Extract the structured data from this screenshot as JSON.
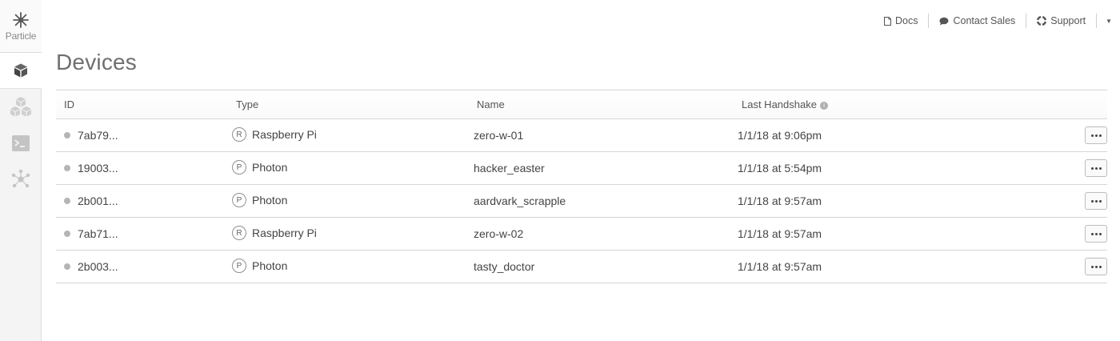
{
  "sidebar": {
    "logo_text": "Particle",
    "items": [
      {
        "name": "devices",
        "icon": "cube-icon",
        "active": true
      },
      {
        "name": "products",
        "icon": "cubes-icon",
        "active": false
      },
      {
        "name": "console",
        "icon": "terminal-icon",
        "active": false
      },
      {
        "name": "integrations",
        "icon": "network-icon",
        "active": false
      }
    ]
  },
  "toplinks": {
    "docs": "Docs",
    "contact_sales": "Contact Sales",
    "support": "Support"
  },
  "page_title": "Devices",
  "table": {
    "columns": {
      "id": "ID",
      "type": "Type",
      "name": "Name",
      "last_handshake": "Last Handshake"
    },
    "rows": [
      {
        "id": "7ab79...",
        "type_badge": "R",
        "type": "Raspberry Pi",
        "name": "zero-w-01",
        "last_handshake": "1/1/18 at 9:06pm"
      },
      {
        "id": "19003...",
        "type_badge": "P",
        "type": "Photon",
        "name": "hacker_easter",
        "last_handshake": "1/1/18 at 5:54pm"
      },
      {
        "id": "2b001...",
        "type_badge": "P",
        "type": "Photon",
        "name": "aardvark_scrapple",
        "last_handshake": "1/1/18 at 9:57am"
      },
      {
        "id": "7ab71...",
        "type_badge": "R",
        "type": "Raspberry Pi",
        "name": "zero-w-02",
        "last_handshake": "1/1/18 at 9:57am"
      },
      {
        "id": "2b003...",
        "type_badge": "P",
        "type": "Photon",
        "name": "tasty_doctor",
        "last_handshake": "1/1/18 at 9:57am"
      }
    ]
  },
  "colors": {
    "sidebar_bg": "#f4f4f4",
    "status_dot": "#b5b5b5",
    "border": "#d6d6d6"
  }
}
